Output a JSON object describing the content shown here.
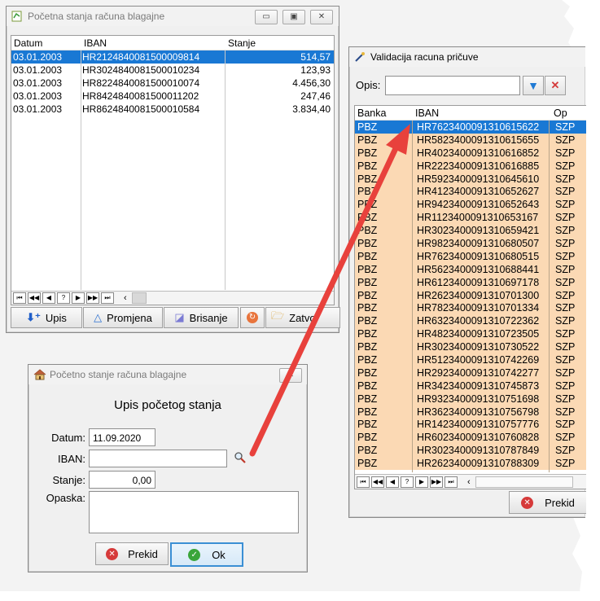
{
  "win1": {
    "title": "Početna stanja računa blagajne",
    "columns": [
      "Datum",
      "IBAN",
      "Stanje"
    ],
    "rows": [
      {
        "datum": "03.01.2003",
        "iban": "HR2124840081500009814",
        "stanje": "514,57"
      },
      {
        "datum": "03.01.2003",
        "iban": "HR3024840081500010234",
        "stanje": "123,93"
      },
      {
        "datum": "03.01.2003",
        "iban": "HR8224840081500010074",
        "stanje": "4.456,30"
      },
      {
        "datum": "03.01.2003",
        "iban": "HR8424840081500011202",
        "stanje": "247,46"
      },
      {
        "datum": "03.01.2003",
        "iban": "HR8624840081500010584",
        "stanje": "3.834,40"
      }
    ],
    "nav": [
      "⏮",
      "◀◀",
      "◀",
      "?",
      "▶",
      "▶▶",
      "⏭"
    ],
    "buttons": {
      "upis": "Upis",
      "promjena": "Promjena",
      "brisanje": "Brisanje",
      "zatvori": "Zatvo"
    }
  },
  "win2": {
    "title": "Početno stanje računa blagajne",
    "heading": "Upis početog stanja",
    "labels": {
      "datum": "Datum:",
      "iban": "IBAN:",
      "stanje": "Stanje:",
      "opaska": "Opaska:"
    },
    "values": {
      "datum": "11.09.2020",
      "iban": "",
      "stanje": "0,00",
      "opaska": ""
    },
    "buttons": {
      "prekid": "Prekid",
      "ok": "Ok"
    }
  },
  "win3": {
    "title": "Validacija racuna pričuve",
    "search_label": "Opis:",
    "search_value": "",
    "columns": [
      "Banka",
      "IBAN",
      "Op"
    ],
    "rows": [
      {
        "banka": "PBZ",
        "iban": "HR7623400091310615622",
        "op": "SZP"
      },
      {
        "banka": "PBZ",
        "iban": "HR5823400091310615655",
        "op": "SZP"
      },
      {
        "banka": "PBZ",
        "iban": "HR4023400091310616852",
        "op": "SZP"
      },
      {
        "banka": "PBZ",
        "iban": "HR2223400091310616885",
        "op": "SZP"
      },
      {
        "banka": "PBZ",
        "iban": "HR5923400091310645610",
        "op": "SZP"
      },
      {
        "banka": "PBZ",
        "iban": "HR4123400091310652627",
        "op": "SZP"
      },
      {
        "banka": "PBZ",
        "iban": "HR9423400091310652643",
        "op": "SZP"
      },
      {
        "banka": "PBZ",
        "iban": "HR1123400091310653167",
        "op": "SZP"
      },
      {
        "banka": "PBZ",
        "iban": "HR3023400091310659421",
        "op": "SZP"
      },
      {
        "banka": "PBZ",
        "iban": "HR9823400091310680507",
        "op": "SZP"
      },
      {
        "banka": "PBZ",
        "iban": "HR7623400091310680515",
        "op": "SZP"
      },
      {
        "banka": "PBZ",
        "iban": "HR5623400091310688441",
        "op": "SZP"
      },
      {
        "banka": "PBZ",
        "iban": "HR6123400091310697178",
        "op": "SZP"
      },
      {
        "banka": "PBZ",
        "iban": "HR2623400091310701300",
        "op": "SZP"
      },
      {
        "banka": "PBZ",
        "iban": "HR7823400091310701334",
        "op": "SZP"
      },
      {
        "banka": "PBZ",
        "iban": "HR6323400091310722362",
        "op": "SZP"
      },
      {
        "banka": "PBZ",
        "iban": "HR4823400091310723505",
        "op": "SZP"
      },
      {
        "banka": "PBZ",
        "iban": "HR3023400091310730522",
        "op": "SZP"
      },
      {
        "banka": "PBZ",
        "iban": "HR5123400091310742269",
        "op": "SZP"
      },
      {
        "banka": "PBZ",
        "iban": "HR2923400091310742277",
        "op": "SZP"
      },
      {
        "banka": "PBZ",
        "iban": "HR3423400091310745873",
        "op": "SZP"
      },
      {
        "banka": "PBZ",
        "iban": "HR9323400091310751698",
        "op": "SZP"
      },
      {
        "banka": "PBZ",
        "iban": "HR3623400091310756798",
        "op": "SZP"
      },
      {
        "banka": "PBZ",
        "iban": "HR1423400091310757776",
        "op": "SZP"
      },
      {
        "banka": "PBZ",
        "iban": "HR6023400091310760828",
        "op": "SZP"
      },
      {
        "banka": "PBZ",
        "iban": "HR3023400091310787849",
        "op": "SZP"
      },
      {
        "banka": "PBZ",
        "iban": "HR2623400091310788309",
        "op": "SZP"
      }
    ],
    "nav": [
      "⏮",
      "◀◀",
      "◀",
      "?",
      "▶",
      "▶▶",
      "⏭"
    ],
    "buttons": {
      "prekid": "Prekid"
    }
  },
  "colors": {
    "selection": "#1978d4",
    "row_tan": "#fbd9b4",
    "arrow": "#e8413c"
  }
}
